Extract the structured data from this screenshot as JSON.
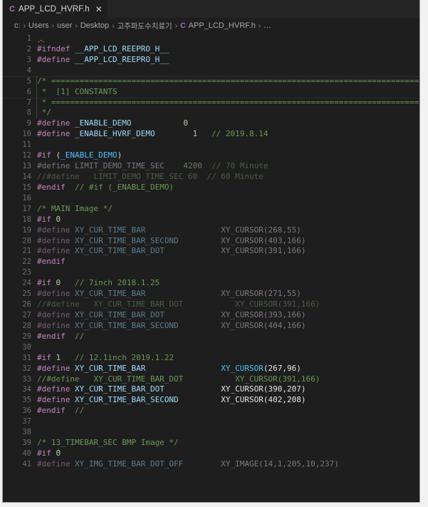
{
  "window": {
    "app": "Visual Studio Code",
    "background": "#1e1e1e"
  },
  "tab": {
    "icon": "c-file-icon",
    "icon_glyph": "C",
    "label": "APP_LCD_HVRF.h",
    "close_glyph": "✕"
  },
  "breadcrumb": {
    "separator": "›",
    "items": [
      {
        "label": "c:"
      },
      {
        "label": "Users"
      },
      {
        "label": "user"
      },
      {
        "label": "Desktop"
      },
      {
        "label": "고주파도수치료기",
        "korean": true
      },
      {
        "label": "APP_LCD_HVRF.h",
        "icon": "C"
      },
      {
        "label": "…"
      }
    ]
  },
  "colors": {
    "editor_background": "#1e1e1e",
    "tabbar_background": "#252526",
    "line_number": "#6d6d6d",
    "preprocessor": "#c586c0",
    "macro_name": "#9cdcfe",
    "macro_reference": "#4fc1ff",
    "number": "#b5cea8",
    "comment": "#6a9955",
    "plain_text": "#d4d4d4",
    "inactive_region": "#7b7b7b",
    "file_icon": "#a074c4"
  },
  "editor": {
    "language": "c-header",
    "first_visible_line": 1,
    "last_visible_line": 41,
    "lines": [
      {
        "n": 1,
        "tokens": []
      },
      {
        "n": 2,
        "tokens": [
          {
            "t": "#ifndef ",
            "c": "t-pp"
          },
          {
            "t": "__APP_LCD_REEPRO_H__",
            "c": "t-macro"
          }
        ]
      },
      {
        "n": 3,
        "tokens": [
          {
            "t": "#define ",
            "c": "t-pp"
          },
          {
            "t": "__APP_LCD_REEPRO_H__",
            "c": "t-macro"
          }
        ]
      },
      {
        "n": 4,
        "tokens": []
      },
      {
        "n": 5,
        "tokens": [
          {
            "t": "/* ==============================================================================",
            "c": "t-cmt"
          }
        ]
      },
      {
        "n": 6,
        "tokens": [
          {
            "t": " *  [1] CONSTANTS",
            "c": "t-cmt"
          }
        ]
      },
      {
        "n": 7,
        "tokens": [
          {
            "t": " * ==============================================================================",
            "c": "t-cmt"
          }
        ]
      },
      {
        "n": 8,
        "tokens": [
          {
            "t": " */",
            "c": "t-cmt"
          }
        ]
      },
      {
        "n": 9,
        "tokens": [
          {
            "t": "#define ",
            "c": "t-pp"
          },
          {
            "t": "_ENABLE_DEMO",
            "c": "t-macro"
          },
          {
            "t": "           ",
            "c": "t-plain"
          },
          {
            "t": "0",
            "c": "t-num"
          }
        ]
      },
      {
        "n": 10,
        "tokens": [
          {
            "t": "#define ",
            "c": "t-pp"
          },
          {
            "t": "_ENABLE_HVRF_DEMO",
            "c": "t-macro"
          },
          {
            "t": "        ",
            "c": "t-plain"
          },
          {
            "t": "1",
            "c": "t-num"
          },
          {
            "t": "   ",
            "c": "t-plain"
          },
          {
            "t": "// 2019.8.14",
            "c": "t-cmt"
          }
        ]
      },
      {
        "n": 11,
        "tokens": []
      },
      {
        "n": 12,
        "tokens": [
          {
            "t": "#if ",
            "c": "t-pp"
          },
          {
            "t": "(",
            "c": "t-plain"
          },
          {
            "t": "_ENABLE_DEMO",
            "c": "t-macro2"
          },
          {
            "t": ")",
            "c": "t-plain"
          }
        ]
      },
      {
        "n": 13,
        "tokens": [
          {
            "t": "#define ",
            "c": "t-dim"
          },
          {
            "t": "LIMIT_DEMO_TIME_SEC",
            "c": "t-dim"
          },
          {
            "t": "    ",
            "c": "t-dim"
          },
          {
            "t": "4200",
            "c": "t-dimnum"
          },
          {
            "t": "  ",
            "c": "t-dim"
          },
          {
            "t": "// 70 Minute",
            "c": "t-dimcmt"
          }
        ]
      },
      {
        "n": 14,
        "tokens": [
          {
            "t": "//#define   LIMIT_DEMO_TIME_SEC 60  // 60 Minute",
            "c": "t-dimcmt"
          }
        ]
      },
      {
        "n": 15,
        "tokens": [
          {
            "t": "#endif ",
            "c": "t-pp"
          },
          {
            "t": " ",
            "c": "t-plain"
          },
          {
            "t": "// #if (_ENABLE_DEMO)",
            "c": "t-cmt"
          }
        ]
      },
      {
        "n": 16,
        "tokens": []
      },
      {
        "n": 17,
        "tokens": [
          {
            "t": "/* MAIN Image */",
            "c": "t-cmt"
          }
        ]
      },
      {
        "n": 18,
        "tokens": [
          {
            "t": "#if ",
            "c": "t-pp"
          },
          {
            "t": "0",
            "c": "t-num"
          }
        ]
      },
      {
        "n": 19,
        "tokens": [
          {
            "t": "#define ",
            "c": "t-dimpp"
          },
          {
            "t": "XY_CUR_TIME_BAR",
            "c": "t-dimmac"
          },
          {
            "t": "                ",
            "c": "t-dim"
          },
          {
            "t": "XY_CURSOR(268,55)",
            "c": "t-dim"
          }
        ]
      },
      {
        "n": 20,
        "tokens": [
          {
            "t": "#define ",
            "c": "t-dimpp"
          },
          {
            "t": "XY_CUR_TIME_BAR_SECOND",
            "c": "t-dimmac"
          },
          {
            "t": "         ",
            "c": "t-dim"
          },
          {
            "t": "XY_CURSOR(403,166)",
            "c": "t-dim"
          }
        ]
      },
      {
        "n": 21,
        "tokens": [
          {
            "t": "#define ",
            "c": "t-dimpp"
          },
          {
            "t": "XY_CUR_TIME_BAR_DOT",
            "c": "t-dimmac"
          },
          {
            "t": "            ",
            "c": "t-dim"
          },
          {
            "t": "XY_CURSOR(391,166)",
            "c": "t-dim"
          }
        ]
      },
      {
        "n": 22,
        "tokens": [
          {
            "t": "#endif",
            "c": "t-pp"
          }
        ]
      },
      {
        "n": 23,
        "tokens": []
      },
      {
        "n": 24,
        "tokens": [
          {
            "t": "#if ",
            "c": "t-pp"
          },
          {
            "t": "0",
            "c": "t-num"
          },
          {
            "t": "   ",
            "c": "t-plain"
          },
          {
            "t": "// 7inch 2018.1.25",
            "c": "t-cmt"
          }
        ]
      },
      {
        "n": 25,
        "tokens": [
          {
            "t": "#define ",
            "c": "t-dimpp"
          },
          {
            "t": "XY_CUR_TIME_BAR",
            "c": "t-dimmac"
          },
          {
            "t": "                ",
            "c": "t-dim"
          },
          {
            "t": "XY_CURSOR(271,55)",
            "c": "t-dim"
          }
        ]
      },
      {
        "n": 26,
        "tokens": [
          {
            "t": "//#define   XY_CUR_TIME_BAR_DOT           XY_CURSOR(391,166)",
            "c": "t-dimcmt"
          }
        ]
      },
      {
        "n": 27,
        "tokens": [
          {
            "t": "#define ",
            "c": "t-dimpp"
          },
          {
            "t": "XY_CUR_TIME_BAR_DOT",
            "c": "t-dimmac"
          },
          {
            "t": "            ",
            "c": "t-dim"
          },
          {
            "t": "XY_CURSOR(393,166)",
            "c": "t-dim"
          }
        ]
      },
      {
        "n": 28,
        "tokens": [
          {
            "t": "#define ",
            "c": "t-dimpp"
          },
          {
            "t": "XY_CUR_TIME_BAR_SECOND",
            "c": "t-dimmac"
          },
          {
            "t": "         ",
            "c": "t-dim"
          },
          {
            "t": "XY_CURSOR(404,166)",
            "c": "t-dim"
          }
        ]
      },
      {
        "n": 29,
        "tokens": [
          {
            "t": "#endif ",
            "c": "t-pp"
          },
          {
            "t": " ",
            "c": "t-plain"
          },
          {
            "t": "//",
            "c": "t-cmt"
          }
        ]
      },
      {
        "n": 30,
        "tokens": []
      },
      {
        "n": 31,
        "tokens": [
          {
            "t": "#if ",
            "c": "t-pp"
          },
          {
            "t": "1",
            "c": "t-num"
          },
          {
            "t": "   ",
            "c": "t-plain"
          },
          {
            "t": "// 12.1inch 2019.1.22",
            "c": "t-cmt"
          }
        ]
      },
      {
        "n": 32,
        "tokens": [
          {
            "t": "#define ",
            "c": "t-pp"
          },
          {
            "t": "XY_CUR_TIME_BAR",
            "c": "t-macro"
          },
          {
            "t": "                ",
            "c": "t-plain"
          },
          {
            "t": "XY_CURSOR",
            "c": "t-macro2"
          },
          {
            "t": "(267,96)",
            "c": "t-white"
          }
        ]
      },
      {
        "n": 33,
        "tokens": [
          {
            "t": "//#define   XY_CUR_TIME_BAR_DOT           XY_CURSOR(391,166)",
            "c": "t-cmt"
          }
        ]
      },
      {
        "n": 34,
        "tokens": [
          {
            "t": "#define ",
            "c": "t-pp"
          },
          {
            "t": "XY_CUR_TIME_BAR_DOT",
            "c": "t-macro"
          },
          {
            "t": "            ",
            "c": "t-plain"
          },
          {
            "t": "XY_CURSOR(390,207)",
            "c": "t-white"
          }
        ]
      },
      {
        "n": 35,
        "tokens": [
          {
            "t": "#define ",
            "c": "t-pp"
          },
          {
            "t": "XY_CUR_TIME_BAR_SECOND",
            "c": "t-macro"
          },
          {
            "t": "         ",
            "c": "t-plain"
          },
          {
            "t": "XY_CURSOR(402,208)",
            "c": "t-white"
          }
        ]
      },
      {
        "n": 36,
        "tokens": [
          {
            "t": "#endif ",
            "c": "t-pp"
          },
          {
            "t": " ",
            "c": "t-plain"
          },
          {
            "t": "//",
            "c": "t-cmt"
          }
        ]
      },
      {
        "n": 37,
        "tokens": []
      },
      {
        "n": 38,
        "tokens": []
      },
      {
        "n": 39,
        "tokens": [
          {
            "t": "/* 13_TIMEBAR_SEC BMP Image */",
            "c": "t-cmt"
          }
        ]
      },
      {
        "n": 40,
        "tokens": [
          {
            "t": "#if ",
            "c": "t-pp"
          },
          {
            "t": "0",
            "c": "t-num"
          }
        ]
      },
      {
        "n": 41,
        "tokens": [
          {
            "t": "#define ",
            "c": "t-dimpp"
          },
          {
            "t": "XY_IMG_TIME_BAR_DOT_OFF",
            "c": "t-dimmac"
          },
          {
            "t": "        ",
            "c": "t-dim"
          },
          {
            "t": "XY_IMAGE(14,1,205,10,237)",
            "c": "t-dim"
          }
        ]
      }
    ]
  }
}
